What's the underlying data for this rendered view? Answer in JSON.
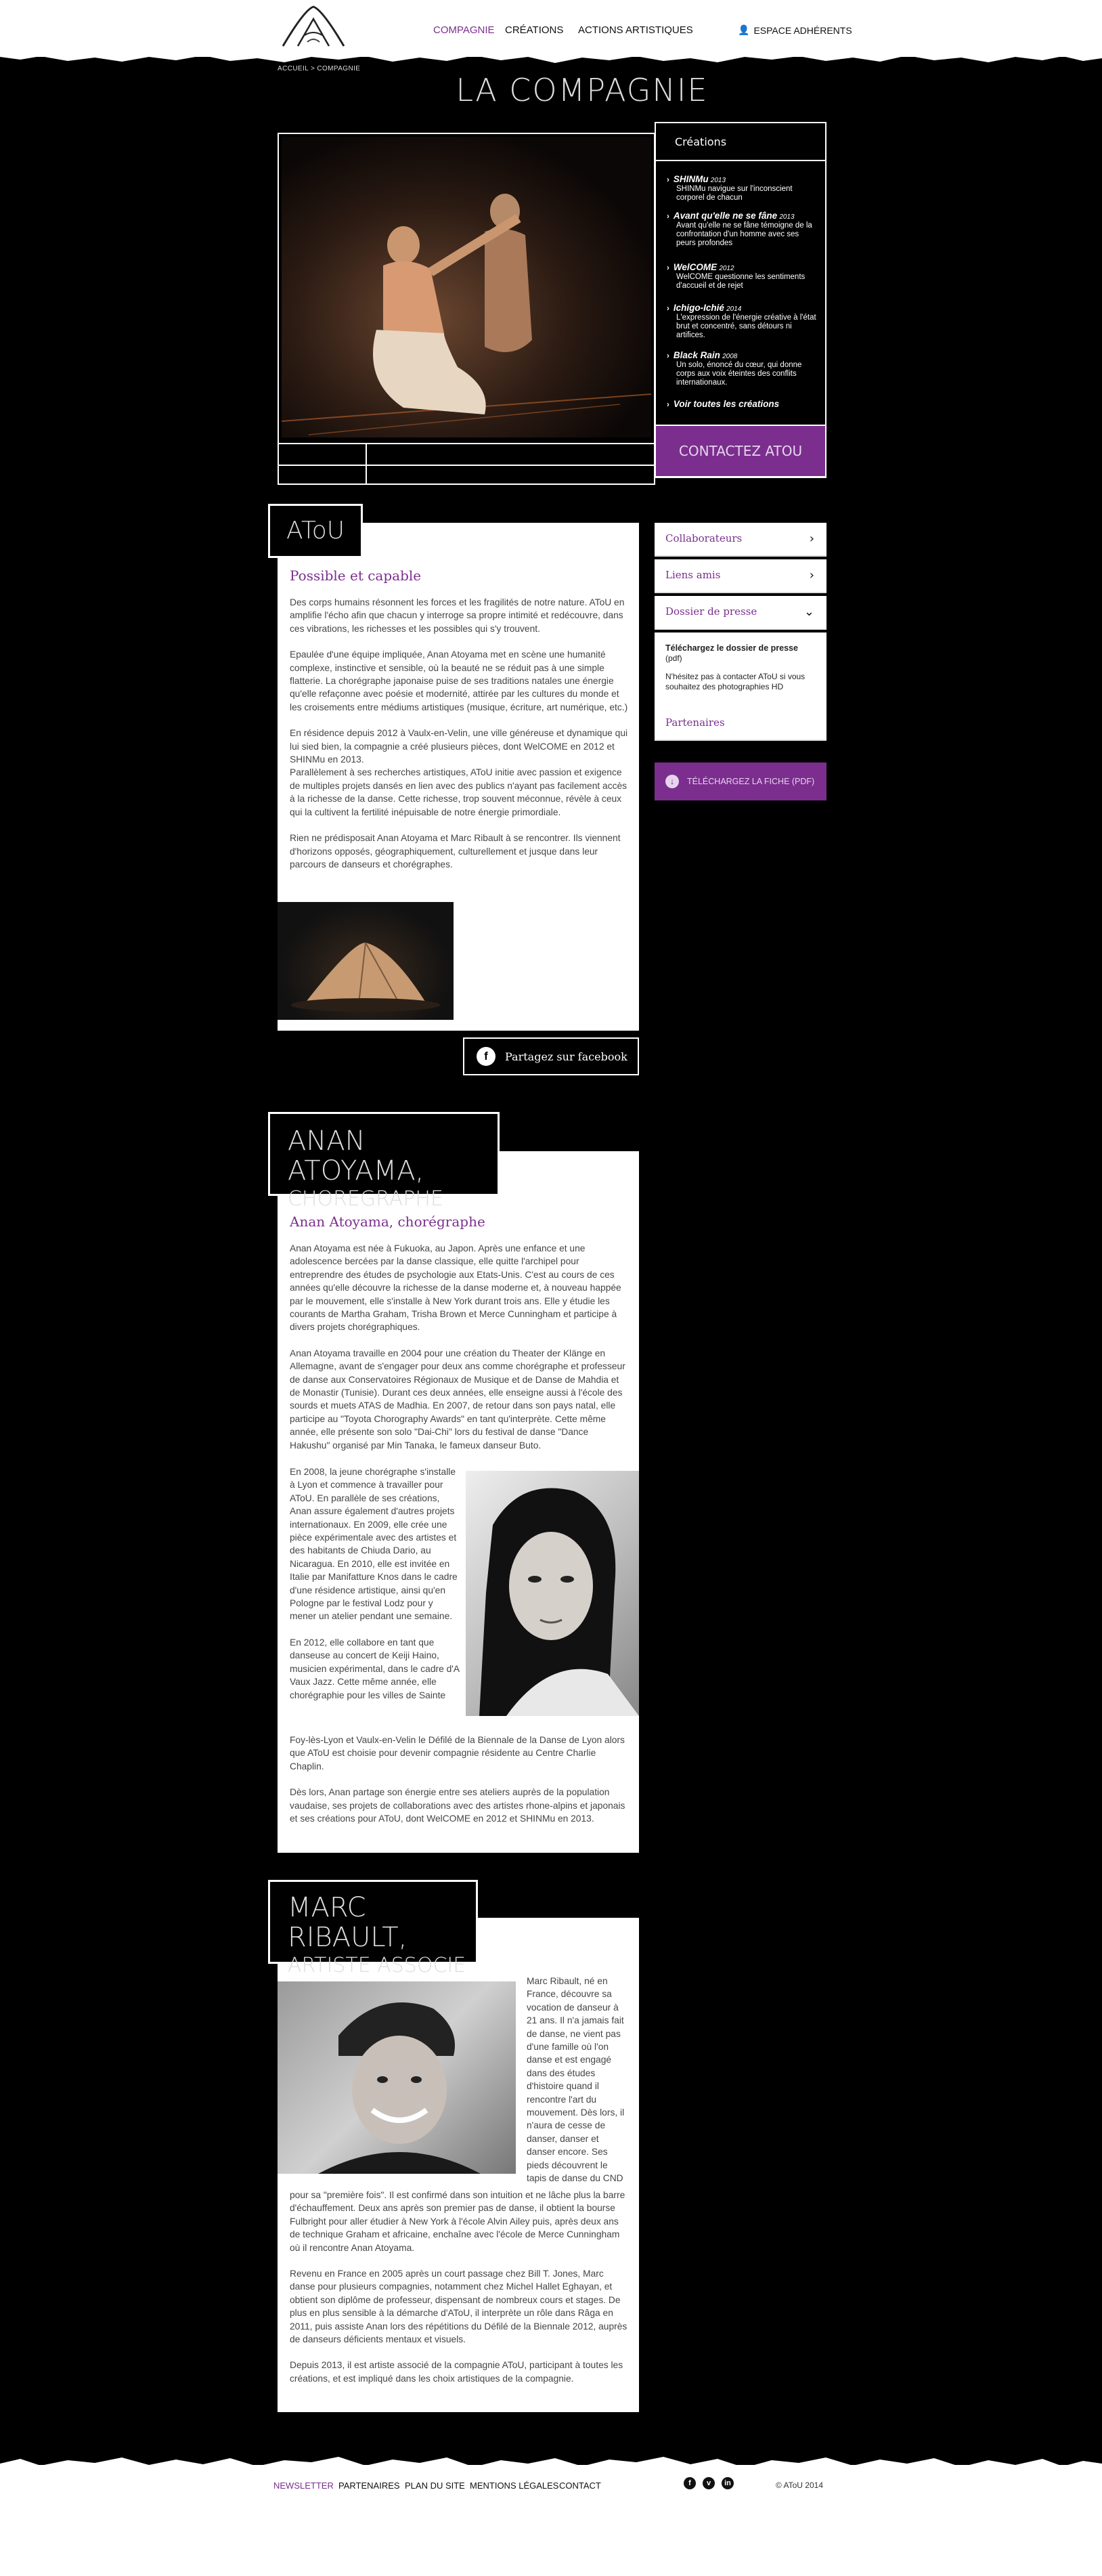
{
  "header": {
    "nav": [
      "COMPAGNIE",
      "CRÉATIONS",
      "ACTIONS ARTISTIQUES"
    ],
    "member_area": "ESPACE ADHÉRENTS"
  },
  "breadcrumb": "ACCUEIL > COMPAGNIE",
  "page_title": "LA COMPAGNIE",
  "creations": {
    "heading": "Créations",
    "items": [
      {
        "title": "SHINMu",
        "year": "2013",
        "desc": "SHINMu navigue sur l'inconscient corporel de chacun"
      },
      {
        "title": "Avant qu'elle ne se fâne",
        "year": "2013",
        "desc": "Avant qu'elle ne se fâne témoigne de la confrontation d'un homme avec ses peurs profondes"
      },
      {
        "title": "WelCOME",
        "year": "2012",
        "desc": "WelCOME questionne les sentiments d'accueil et de rejet"
      },
      {
        "title": "Ichigo-Ichié",
        "year": "2014",
        "desc": "L'expression de l'énergie créative à l'état brut et concentré, sans détours ni artifices."
      },
      {
        "title": "Black Rain",
        "year": "2008",
        "desc": "Un solo, énoncé du cœur, qui donne corps aux voix éteintes des conflits internationaux."
      }
    ],
    "see_all": "Voir toutes les créations",
    "contact": "CONTACTEZ ATOU"
  },
  "sidebar": {
    "collaborateurs": "Collaborateurs",
    "liens": "Liens amis",
    "presse": "Dossier de presse",
    "presse_title": "Téléchargez le dossier de presse",
    "presse_format": "(pdf)",
    "presse_desc": "N'hésitez pas à contacter AToU si vous souhaitez des photographies HD",
    "partenaires": "Partenaires",
    "download": "TÉLÉCHARGEZ LA FICHE (PDF)"
  },
  "atou": {
    "title": "AToU",
    "subtitle": "Possible et capable",
    "paragraphs": [
      "Des corps humains résonnent les forces et les fragilités de notre nature. AToU en amplifie l'écho afin que chacun y interroge sa propre intimité et redécouvre, dans ces vibrations, les richesses et les possibles qui s'y trouvent.",
      "Epaulée d'une équipe impliquée, Anan Atoyama met en scène une humanité complexe, instinctive et sensible, où la beauté ne se réduit pas à une simple flatterie. La chorégraphe japonaise puise de ses traditions natales une énergie qu'elle refaçonne avec poésie et modernité, attirée par les cultures du monde et les croisements entre médiums artistiques (musique, écriture, art numérique, etc.)",
      "En résidence depuis 2012 à Vaulx-en-Velin, une ville généreuse et dynamique qui lui sied bien, la compagnie a créé plusieurs pièces, dont WelCOME en 2012 et SHINMu en 2013.\nParallèlement à ses recherches artistiques, AToU initie avec passion et exigence de multiples projets dansés en lien avec des publics n'ayant pas facilement accès à la richesse de la danse. Cette richesse, trop souvent méconnue, révèle à ceux qui la cultivent la fertilité inépuisable de notre énergie primordiale.",
      "Rien ne prédisposait Anan Atoyama et Marc Ribault à se rencontrer. Ils viennent d'horizons opposés, géographiquement, culturellement et jusque dans leur parcours de danseurs et chorégraphes."
    ],
    "share": "Partagez sur facebook"
  },
  "anan": {
    "title_line1": "ANAN ATOYAMA,",
    "title_line2": "CHOREGRAPHE",
    "subtitle": "Anan Atoyama, chorégraphe",
    "p1": "Anan Atoyama est née à Fukuoka, au Japon. Après une enfance et une adolescence bercées par la danse classique, elle quitte l'archipel pour entreprendre des études de psychologie aux Etats-Unis. C'est au cours de ces années qu'elle découvre la richesse de la danse moderne et, à nouveau happée par le mouvement, elle s'installe à New York durant trois ans. Elle y étudie les courants de Martha Graham, Trisha Brown et Merce Cunningham et participe à divers projets chorégraphiques.",
    "p2": "Anan Atoyama travaille en 2004 pour une création du Theater der Klänge en Allemagne, avant de s'engager pour deux ans comme chorégraphe et professeur de danse aux Conservatoires Régionaux de Musique et de Danse de Mahdia et de Monastir (Tunisie). Durant ces deux années, elle enseigne aussi à l'école des sourds et muets ATAS de Madhia. En 2007, de retour dans son pays natal, elle participe au \"Toyota Chorography Awards\" en tant qu'interprète. Cette même année, elle présente son solo \"Dai-Chi\" lors du festival de danse \"Dance Hakushu\" organisé par Min Tanaka, le fameux danseur Buto.",
    "p3": "En 2008, la jeune chorégraphe s'installe à Lyon et commence à travailler pour AToU. En parallèle de ses créations, Anan assure également d'autres projets internationaux. En 2009, elle crée une pièce expérimentale avec des artistes et des habitants de Chiuda Dario, au Nicaragua. En 2010, elle est invitée en Italie par Manifatture Knos dans le cadre d'une résidence artistique, ainsi qu'en Pologne par le festival Lodz pour y mener un atelier pendant une semaine.",
    "p4a": "En 2012, elle collabore en tant que danseuse au concert de Keiji Haino, musicien expérimental, dans le cadre d'A Vaux Jazz. Cette même année, elle chorégraphie pour les villes de Sainte",
    "p4b": "Foy-lès-Lyon et Vaulx-en-Velin le Défilé de la Biennale de la Danse de Lyon alors que AToU est choisie pour devenir compagnie résidente au Centre Charlie Chaplin.",
    "p5": "Dès lors, Anan partage son énergie entre ses ateliers auprès de la population vaudaise, ses projets de collaborations avec des artistes rhone-alpins et japonais et ses créations pour AToU, dont WelCOME en 2012 et SHINMu en 2013."
  },
  "marc": {
    "title_line1": "MARC RIBAULT,",
    "title_line2": "ARTISTE ASSOCIE",
    "p1a": "Marc Ribault, né en France, découvre sa vocation de danseur à 21 ans. Il n'a jamais fait de danse, ne vient pas d'une famille où l'on danse et est engagé dans des études d'histoire quand il rencontre l'art du mouvement. Dès lors, il n'aura de cesse de danser, danser et danser encore. Ses pieds découvrent le tapis de danse du CND",
    "p1b": "pour sa \"première fois\". Il est confirmé dans son intuition et ne lâche plus la barre d'échauffement. Deux ans après son premier pas de danse, il obtient la bourse Fulbright pour aller étudier à New York à l'école Alvin Ailey puis, après deux ans de technique Graham et africaine, enchaîne avec l'école de Merce Cunningham où il rencontre Anan Atoyama.",
    "p2": "Revenu en France en 2005 après un court passage chez Bill T. Jones, Marc danse pour plusieurs compagnies, notamment chez Michel Hallet Eghayan, et obtient son diplôme de professeur, dispensant de nombreux cours et stages. De plus en plus sensible à la démarche d'AToU, il interprète un rôle dans Râga en 2011, puis assiste Anan lors des répétitions du Défilé de la Biennale 2012, auprès de danseurs déficients mentaux et visuels.",
    "p3": "Depuis 2013, il est artiste associé de la compagnie AToU, participant à toutes les créations, et est impliqué dans les choix artistiques de la compagnie."
  },
  "footer": {
    "links": [
      "NEWSLETTER",
      "PARTENAIRES",
      "PLAN DU SITE",
      "MENTIONS LÉGALES",
      "CONTACT"
    ],
    "social": [
      "facebook-icon",
      "vimeo-icon",
      "linkedin-icon"
    ],
    "copyright": "© AToU 2014"
  },
  "colors": {
    "accent": "#7b2e8e",
    "background": "#000000",
    "panel": "#ffffff"
  }
}
